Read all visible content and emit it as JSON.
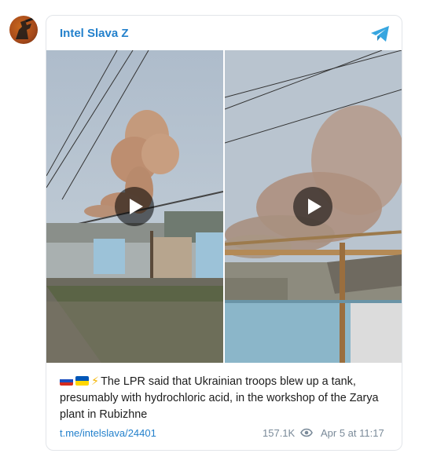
{
  "post": {
    "channel_name": "Intel Slava Z",
    "avatar_icon": "channel-avatar-icon",
    "telegram_icon": "telegram-plane-icon",
    "accent_color": "#2481cc",
    "media": [
      {
        "type": "video",
        "icon": "play-icon"
      },
      {
        "type": "video",
        "icon": "play-icon"
      }
    ],
    "flags": [
      "russia-flag-icon",
      "ukraine-flag-icon",
      "lightning-icon"
    ],
    "message": "The LPR said that Ukrainian troops blew up a tank, presumably with hydrochloric acid, in the workshop of the Zarya plant in Rubizhne",
    "link": "t.me/intelslava/24401",
    "views": "157.1K",
    "date": "Apr 5 at 11:17"
  }
}
